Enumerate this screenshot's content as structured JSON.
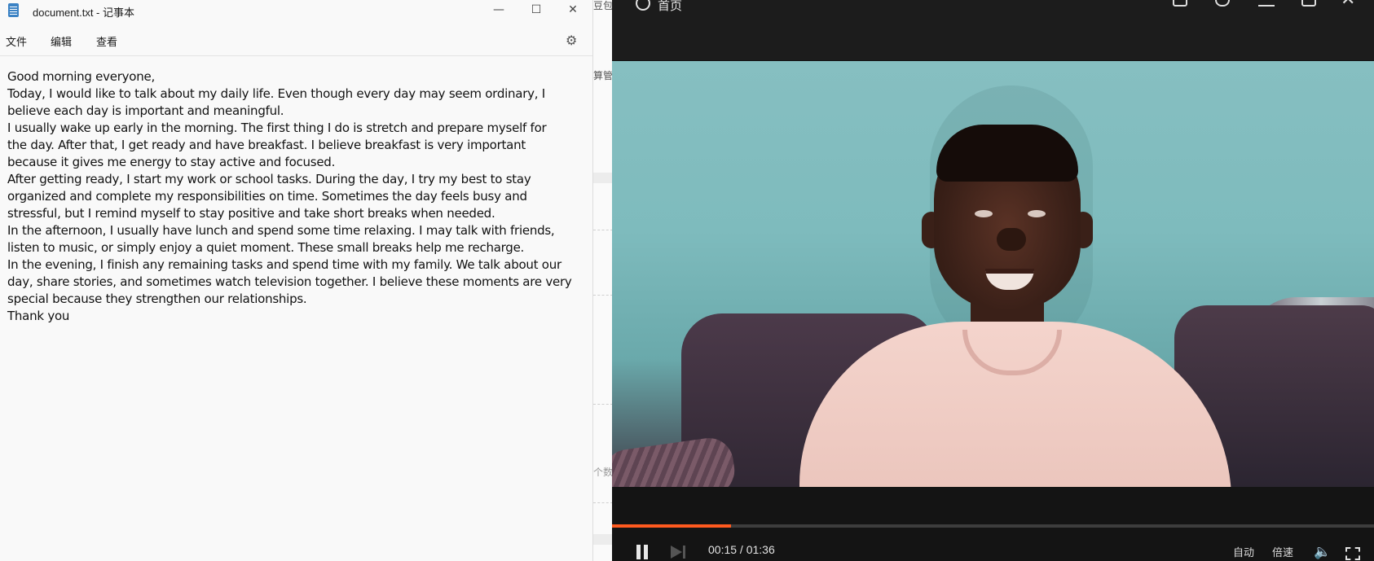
{
  "notepad": {
    "title": "document.txt - 记事本",
    "controls": {
      "minimize": "—",
      "maximize": "☐",
      "close": "✕"
    },
    "menu": {
      "file": "文件",
      "edit": "编辑",
      "view": "查看"
    },
    "settings_icon": "⚙",
    "lines": [
      "Good morning everyone,",
      "Today, I would like to talk about my daily life. Even though every day may seem ordinary, I",
      "believe each day is important and meaningful.",
      "I usually wake up early in the morning. The first thing I do is stretch and prepare myself for",
      "the day. After that, I get ready and have breakfast. I believe breakfast is very important",
      "because it gives me energy to stay active and focused.",
      "After getting ready, I start my work or school tasks. During the day, I try my best to stay",
      "organized and complete my responsibilities on time. Sometimes the day feels busy and",
      "stressful, but I remind myself to stay positive and take short breaks when needed.",
      "In the afternoon, I usually have lunch and spend some time relaxing. I may talk with friends,",
      "listen to music, or simply enjoy a quiet moment. These small breaks help me recharge.",
      "In the evening, I finish any remaining tasks and spend time with my family. We talk about our",
      "day, share stories, and sometimes watch television together. I believe these moments are very",
      "special because they strengthen our relationships.",
      "Thank you"
    ]
  },
  "behind": {
    "text_top": "豆包",
    "text_mid": "算管",
    "text_bottom": "个数"
  },
  "player": {
    "home_label": "首页",
    "close_glyph": "✕",
    "time": "00:15 / 01:36",
    "progress": 0.1563,
    "progress_color": "#ff5a1f",
    "auto_label": "自动",
    "speed_label": "倍速",
    "volume_icon": "🔈"
  }
}
